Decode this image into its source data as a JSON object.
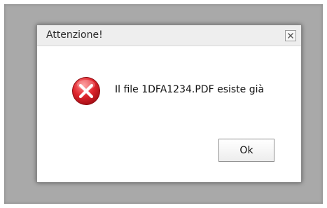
{
  "dialog": {
    "title": "Attenzione!",
    "message": "Il file 1DFA1234.PDF esiste già",
    "ok_label": "Ok",
    "icon": "error-icon",
    "close_icon": "close-icon"
  },
  "colors": {
    "backdrop": "#a9a9a9",
    "titlebar": "#eeeeee",
    "error_red": "#d9252d"
  }
}
